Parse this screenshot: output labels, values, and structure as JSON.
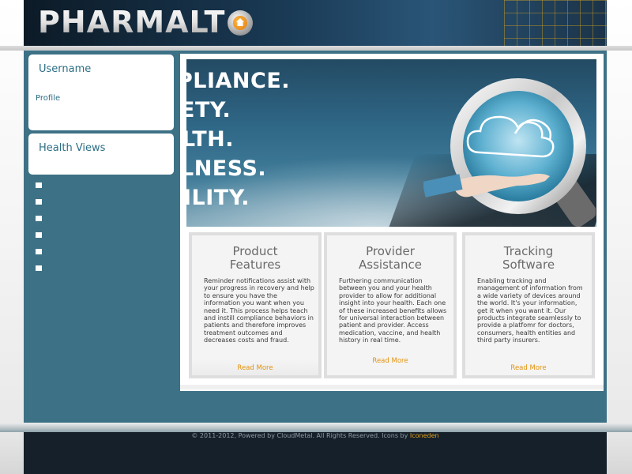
{
  "header": {
    "logo_text": "PHARMALT",
    "logo_icon": "orange-house-circle-icon"
  },
  "sidebar": {
    "username_title": "Username",
    "profile_link": "Profile",
    "health_views_title": "Health Views",
    "bullet_count_shown": 6
  },
  "hero": {
    "lines": [
      "PLIANCE.",
      "ETY.",
      "LTH.",
      "LNESS.",
      "ILITY."
    ],
    "image": "magnifying-glass-cloud-hand"
  },
  "cards": [
    {
      "title_line1": "Product",
      "title_line2": "Features",
      "body": "Reminder notifications assist with your progress in recovery and help to ensure you have the information you want when you need it. This process helps teach and instill compliance behaviors in patients and therefore improves treatment outcomes and decreases costs and fraud.",
      "link": "Read More"
    },
    {
      "title_line1": "Provider",
      "title_line2": "Assistance",
      "body": "Furthering communication between you and your health provider to allow for additional insight into your health. Each one of these increased benefits allows for universal interaction between patient and provider. Access medication, vaccine, and health history in real time.",
      "link": "Read More"
    },
    {
      "title_line1": "Tracking",
      "title_line2": "Software",
      "body": "Enabling tracking and management of information from a wide variety of devices around the world. It's your information, get it when you want it. Our products integrate seamlessly to provide a platfomr for doctors, consumers, health entities and third party insurers.",
      "link": "Read More"
    }
  ],
  "footer": {
    "text": "© 2011-2012, Powered by CloudMetal. All Rights Reserved. Icons by ",
    "link": "Iconeden"
  },
  "colors": {
    "accent_teal": "#3d7186",
    "link_orange": "#e3930f",
    "footer_dark": "#15202b"
  }
}
